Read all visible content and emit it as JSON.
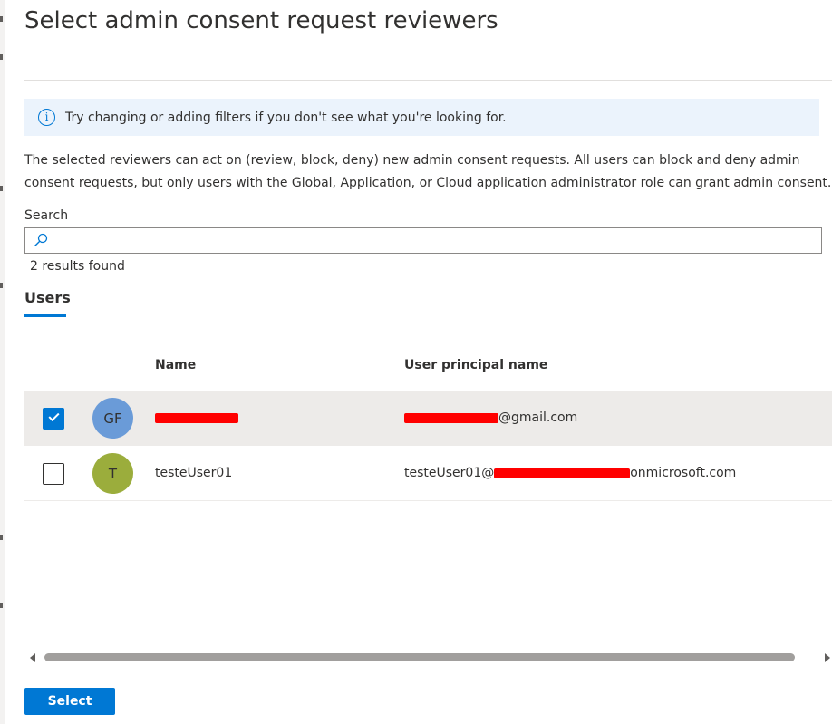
{
  "panel": {
    "title": "Select admin consent request reviewers"
  },
  "info_bar": {
    "icon": "info-icon",
    "text": "Try changing or adding filters if you don't see what you're looking for."
  },
  "description": "The selected reviewers can act on (review, block, deny) new admin consent requests. All users can block and deny admin consent requests, but only users with the Global, Application, or Cloud application administrator role can grant admin consent.",
  "search": {
    "label": "Search",
    "value": "",
    "placeholder": ""
  },
  "results_text": "2 results found",
  "tabs": [
    {
      "label": "Users",
      "active": true
    }
  ],
  "table": {
    "columns": [
      "Name",
      "User principal name"
    ],
    "rows": [
      {
        "checked": true,
        "initials": "GF",
        "avatar_color": "#6a9bd8",
        "name": "",
        "upn_suffix": "@gmail.com"
      },
      {
        "checked": false,
        "initials": "T",
        "avatar_color": "#9bad3c",
        "name": "testeUser01",
        "upn_prefix": "testeUser01@",
        "upn_suffix": "onmicrosoft.com"
      }
    ]
  },
  "footer": {
    "select_label": "Select"
  },
  "colors": {
    "accent": "#0078d4",
    "info_bg": "#ebf3fc",
    "selected_row_bg": "#edebe9",
    "redaction": "#ff0000"
  }
}
